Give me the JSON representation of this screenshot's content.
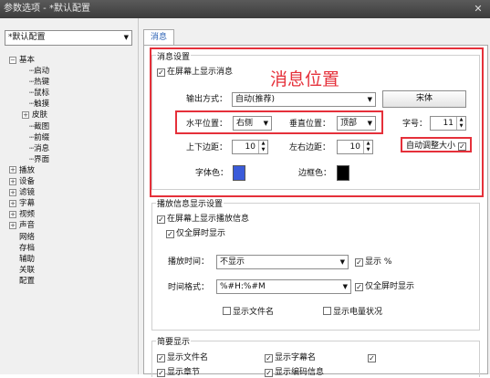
{
  "window": {
    "title": "参数选项 - *默认配置",
    "close_glyph": "✕"
  },
  "sidebar": {
    "profile": "*默认配置",
    "tree": [
      {
        "label": "基本",
        "level": 0,
        "expander": "−"
      },
      {
        "label": "启动",
        "level": 1
      },
      {
        "label": "热键",
        "level": 1
      },
      {
        "label": "鼠标",
        "level": 1
      },
      {
        "label": "触摸",
        "level": 1
      },
      {
        "label": "皮肤",
        "level": 1,
        "expander": "+"
      },
      {
        "label": "截图",
        "level": 1
      },
      {
        "label": "前缀",
        "level": 1
      },
      {
        "label": "消息",
        "level": 1
      },
      {
        "label": "界面",
        "level": 1
      },
      {
        "label": "播放",
        "level": 0,
        "expander": "+"
      },
      {
        "label": "设备",
        "level": 0,
        "expander": "+"
      },
      {
        "label": "滤镜",
        "level": 0,
        "expander": "+"
      },
      {
        "label": "字幕",
        "level": 0,
        "expander": "+"
      },
      {
        "label": "视频",
        "level": 0,
        "expander": "+"
      },
      {
        "label": "声音",
        "level": 0,
        "expander": "+"
      },
      {
        "label": "网络",
        "level": 0
      },
      {
        "label": "存档",
        "level": 0
      },
      {
        "label": "辅助",
        "level": 0
      },
      {
        "label": "关联",
        "level": 0
      },
      {
        "label": "配置",
        "level": 0
      }
    ]
  },
  "tab": {
    "label": "消息"
  },
  "message_settings": {
    "group_title": "消息设置",
    "show_on_screen": "在屏幕上显示消息",
    "output_label": "输出方式：",
    "output_value": "自动(推荐)",
    "font_button": "宋体",
    "h_pos_label": "水平位置：",
    "h_pos_value": "右侧",
    "v_pos_label": "垂直位置：",
    "v_pos_value": "顶部",
    "size_label": "字号：",
    "size_value": "11",
    "vmargin_label": "上下边距：",
    "vmargin_value": "10",
    "hmargin_label": "左右边距：",
    "hmargin_value": "10",
    "autosize_label": "自动调整大小",
    "font_color_label": "字体色：",
    "border_color_label": "边框色："
  },
  "annotation": "消息位置",
  "playback_info": {
    "group_title": "播放信息显示设置",
    "show_on_screen": "在屏幕上显示播放信息",
    "fullscreen_only": "仅全屏时显示",
    "time_label": "播放时间：",
    "time_value": "不显示",
    "show_percent": "显示 %",
    "format_label": "时间格式：",
    "format_value": "%#H:%#M",
    "fullscreen_only2": "仅全屏时显示",
    "show_filename": "显示文件名",
    "show_battery": "显示电量状况"
  },
  "brief": {
    "group_title": "简要显示",
    "show_filename": "显示文件名",
    "show_subtitle_name": "显示字幕名",
    "show_chapter": "显示章节",
    "show_codec": "显示编码信息"
  },
  "colors": {
    "font_color": "#3a5bd9",
    "border_color": "#000000",
    "annotation_red": "#e5303a",
    "tab_text": "#2b62b5"
  }
}
